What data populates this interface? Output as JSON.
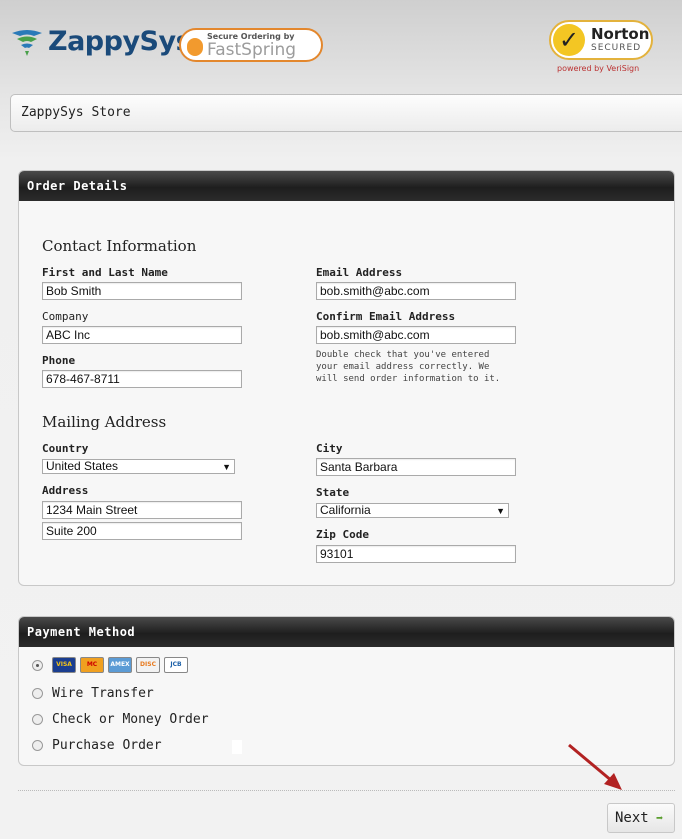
{
  "brand": {
    "logo_text": "ZappySys",
    "fastspring_small": "Secure Ordering by",
    "fastspring_name": "FastSpring",
    "norton_name": "Norton",
    "norton_secured": "SECURED",
    "norton_powered": "powered by VeriSign"
  },
  "store": {
    "title": "ZappySys Store"
  },
  "order_details": {
    "panel_title": "Order Details",
    "contact_title": "Contact Information",
    "name_label": "First and Last Name",
    "name_value": "Bob Smith",
    "company_label": "Company",
    "company_value": "ABC Inc",
    "phone_label": "Phone",
    "phone_value": "678-467-8711",
    "email_label": "Email Address",
    "email_value": "bob.smith@abc.com",
    "confirm_email_label": "Confirm Email Address",
    "confirm_email_value": "bob.smith@abc.com",
    "email_hint": "Double check that you've entered your email address correctly. We will send order information to it.",
    "mailing_title": "Mailing Address",
    "country_label": "Country",
    "country_value": "United States",
    "address_label": "Address",
    "address1_value": "1234 Main Street",
    "address2_value": "Suite 200",
    "city_label": "City",
    "city_value": "Santa Barbara",
    "state_label": "State",
    "state_value": "California",
    "zip_label": "Zip Code",
    "zip_value": "93101"
  },
  "payment": {
    "panel_title": "Payment Method",
    "cards": [
      "VISA",
      "MC",
      "AMEX",
      "DISC",
      "JCB"
    ],
    "options": [
      "Wire Transfer",
      "Check or Money Order",
      "Purchase Order"
    ]
  },
  "footer": {
    "next_label": "Next"
  },
  "colors": {
    "panel_header": "#1e1e1e",
    "accent_orange": "#e3872d",
    "arrow_red": "#b22222",
    "next_arrow_green": "#5a9e2e"
  }
}
